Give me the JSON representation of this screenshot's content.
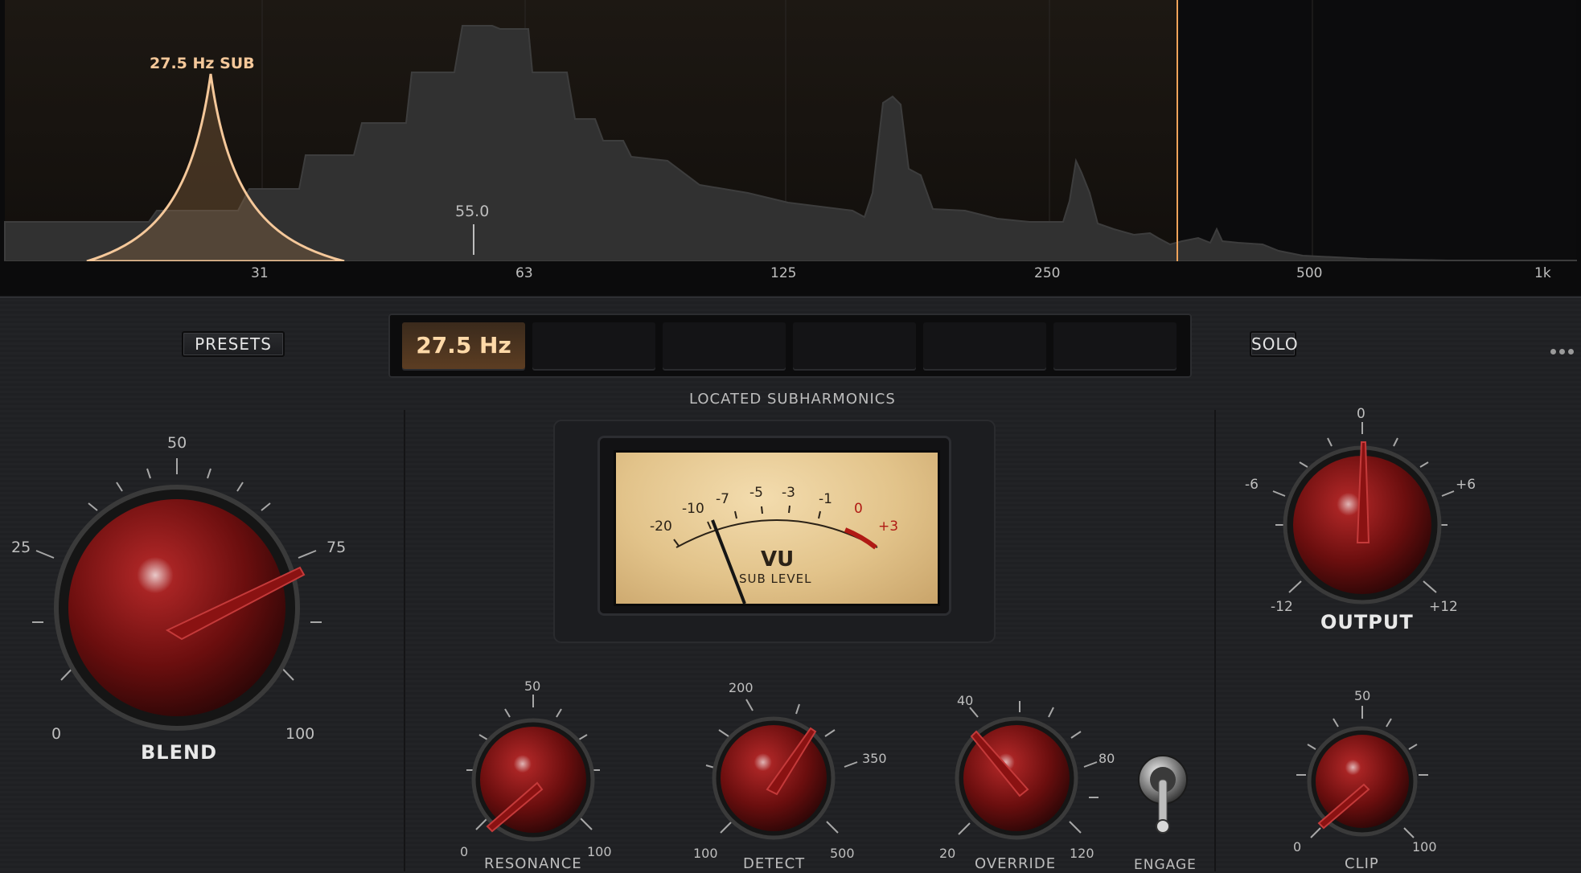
{
  "analyzer": {
    "peak_label": "27.5 Hz  SUB",
    "marker_value": "55.0",
    "freq_ticks": [
      "31",
      "63",
      "125",
      "250",
      "500",
      "1k"
    ]
  },
  "header": {
    "presets_label": "PRESETS",
    "solo_label": "SOLO",
    "slots": [
      "27.5 Hz",
      "",
      "",
      "",
      "",
      ""
    ]
  },
  "section_title": "LOCATED SUBHARMONICS",
  "vu": {
    "scale": [
      "-20",
      "-10",
      "-7",
      "-5",
      "-3",
      "-1",
      "0",
      "+3"
    ],
    "title": "VU",
    "subtitle": "SUB LEVEL"
  },
  "knobs": {
    "blend": {
      "label": "BLEND",
      "ticks": [
        "0",
        "25",
        "50",
        "75",
        "100"
      ]
    },
    "output": {
      "label": "OUTPUT",
      "ticks": [
        "-12",
        "-6",
        "0",
        "+6",
        "+12"
      ]
    },
    "resonance": {
      "label": "RESONANCE",
      "ticks": [
        "0",
        "50",
        "100"
      ]
    },
    "detect": {
      "label": "DETECT",
      "ticks": [
        "100",
        "200",
        "350",
        "500"
      ]
    },
    "override": {
      "label": "OVERRIDE",
      "ticks": [
        "20",
        "40",
        "80",
        "120"
      ]
    },
    "clip": {
      "label": "CLIP",
      "ticks": [
        "0",
        "50",
        "100"
      ]
    }
  },
  "engage": {
    "label": "ENGAGE"
  },
  "colors": {
    "accent": "#f5c89a",
    "knob_red": "#8a1212",
    "meter_face": "#e8cf9c",
    "meter_red": "#b01a14"
  }
}
